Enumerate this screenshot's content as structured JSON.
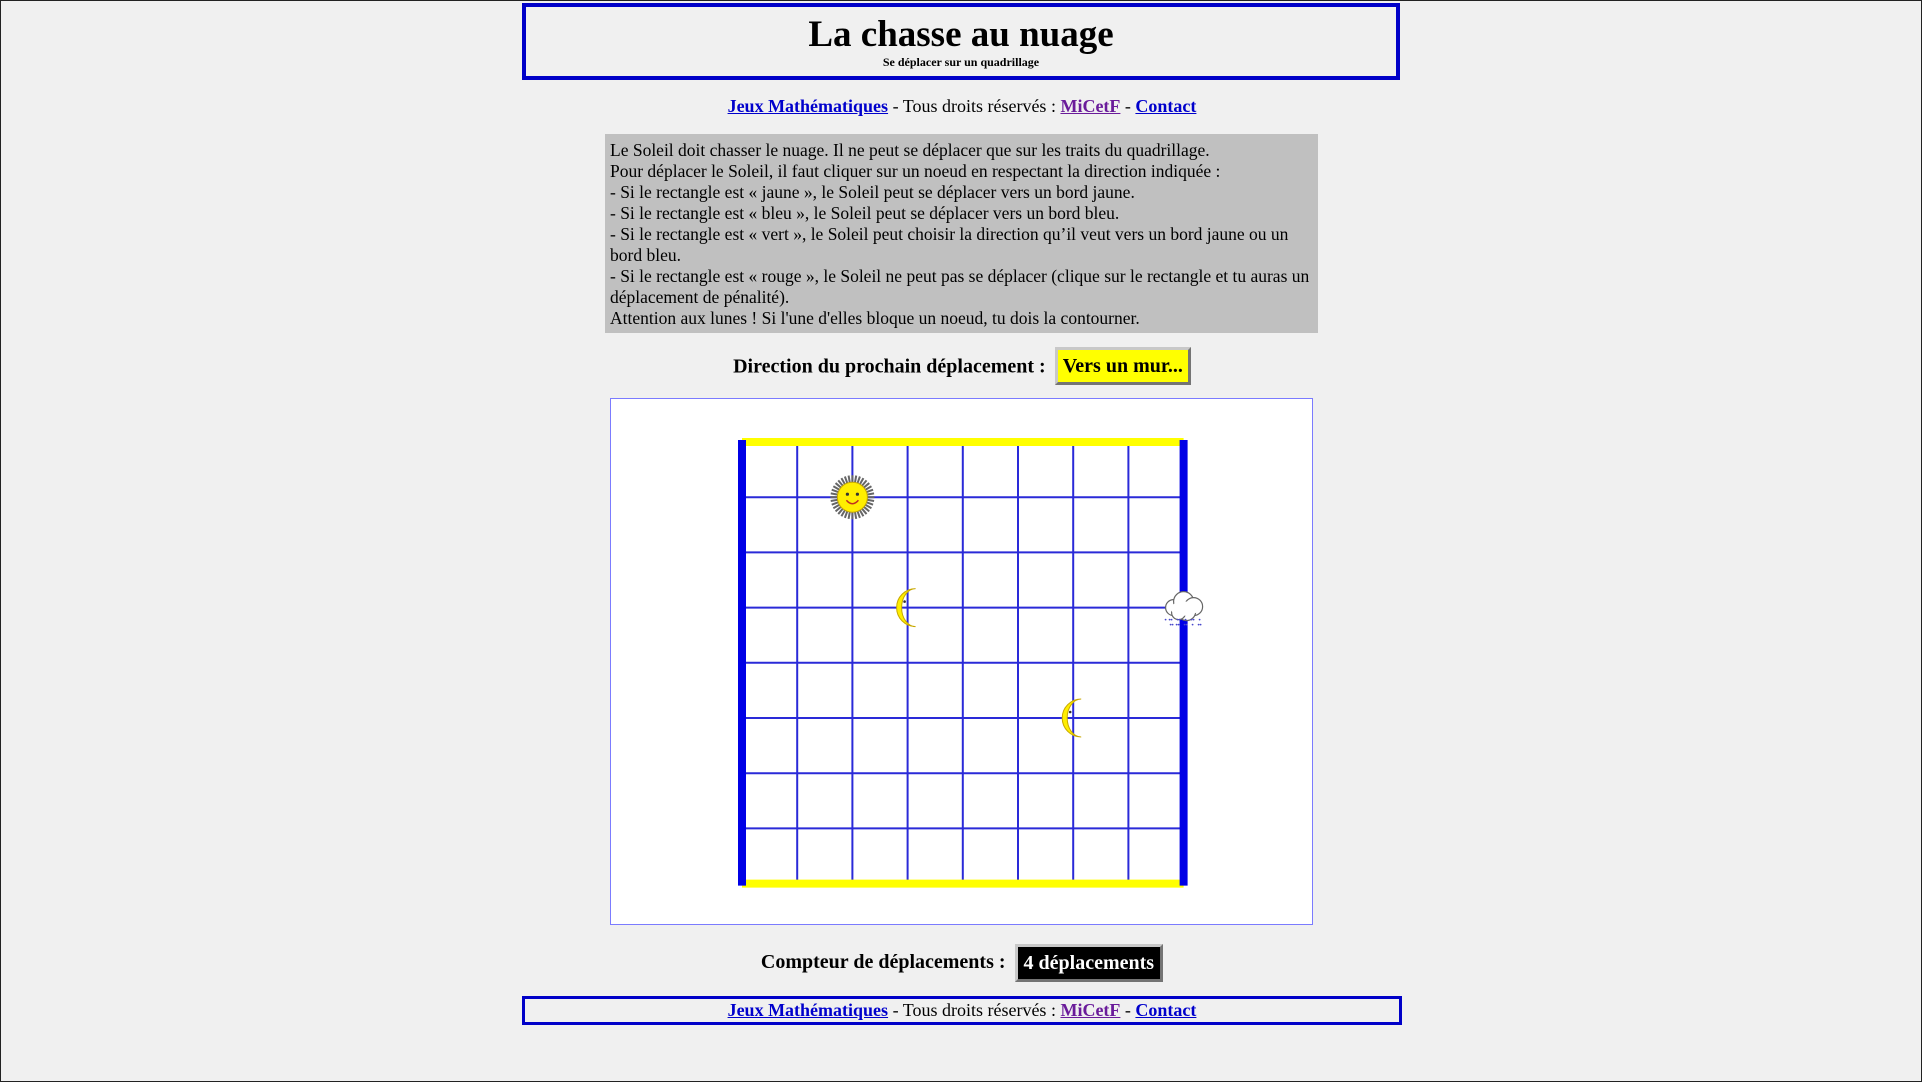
{
  "header": {
    "title": "La chasse au nuage",
    "subtitle": "Se déplacer sur un quadrillage"
  },
  "nav": {
    "games_link": "Jeux Mathématiques",
    "rights_text": " - Tous droits réservés : ",
    "micetf_link": "MiCetF",
    "sep": " - ",
    "contact_link": "Contact"
  },
  "instructions": [
    "Le Soleil doit chasser le nuage. Il ne peut se déplacer que sur les traits du quadrillage.",
    "Pour déplacer le Soleil, il faut cliquer sur un noeud en respectant la direction indiquée :",
    "- Si le rectangle est « jaune », le Soleil peut se déplacer vers un bord jaune.",
    "- Si le rectangle est « bleu », le Soleil peut se déplacer vers un bord bleu.",
    "- Si le rectangle est « vert », le Soleil peut choisir la direction qu’il veut vers un bord jaune ou un bord bleu.",
    "- Si le rectangle est « rouge », le Soleil ne peut pas se déplacer (clique sur le rectangle et tu auras un déplacement de pénalité).",
    "Attention aux lunes ! Si l'une d'elles bloque un noeud, tu dois la contourner."
  ],
  "direction": {
    "label": "Direction du prochain déplacement :",
    "value": "Vers un mur...",
    "color": "#ffff00"
  },
  "board": {
    "cols": 8,
    "rows": 8,
    "grid_color": "#2a2ad8",
    "yellow_edge_color": "#ffff00",
    "blue_edge_color": "#0000e6",
    "sun": {
      "col": 2,
      "row": 1,
      "icon": "sun-icon"
    },
    "moons": [
      {
        "col": 3,
        "row": 3,
        "icon": "moon-icon"
      },
      {
        "col": 6,
        "row": 5,
        "icon": "moon-icon"
      }
    ],
    "cloud": {
      "col": 8,
      "row": 3,
      "icon": "cloud-icon"
    }
  },
  "counter": {
    "label": "Compteur de déplacements :",
    "value": "4 déplacements"
  }
}
